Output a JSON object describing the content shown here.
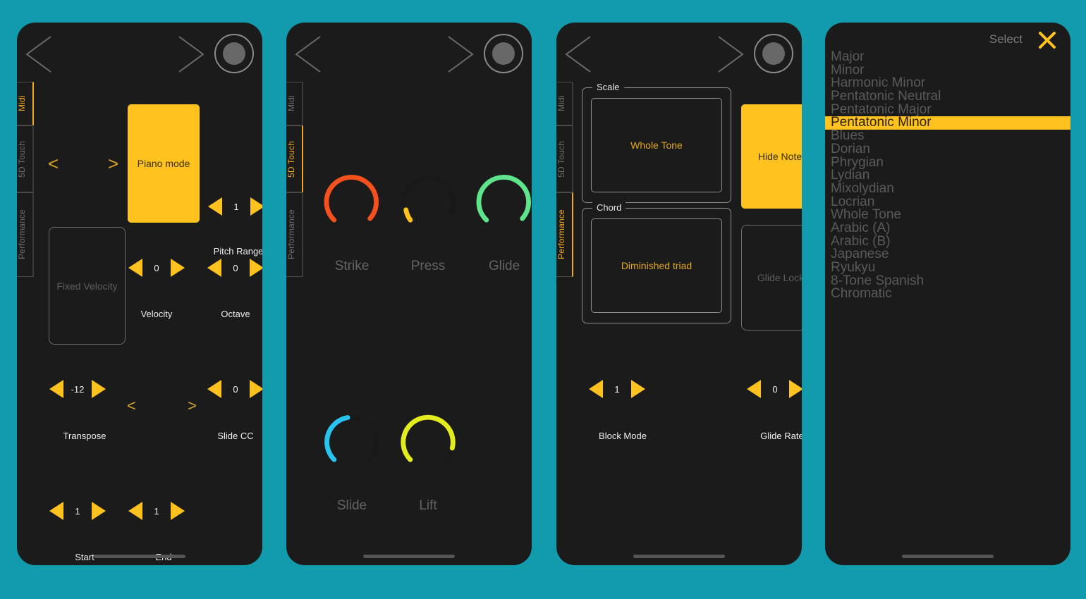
{
  "theme": {
    "page_background": "#119bad",
    "panel_background": "#1b1b1b",
    "accent": "#ffc21e",
    "accent_text": "#e3a81c",
    "muted_text": "#5a5a5a"
  },
  "panels": [
    {
      "id": "midi",
      "tabs": [
        {
          "label": "Midi",
          "active": true
        },
        {
          "label": "5D Touch",
          "active": false
        },
        {
          "label": "Performance",
          "active": false
        }
      ],
      "mode_button": {
        "label": "Piano mode",
        "state": "on"
      },
      "prev_chevron": "<",
      "next_chevron": ">",
      "fixed_velocity": {
        "label": "Fixed Velocity",
        "state": "off"
      },
      "steppers": [
        {
          "name": "pitch-range",
          "label": "Pitch Range",
          "value": "1"
        },
        {
          "name": "velocity",
          "label": "Velocity",
          "value": "0"
        },
        {
          "name": "octave",
          "label": "Octave",
          "value": "0"
        },
        {
          "name": "transpose",
          "label": "Transpose",
          "value": "-12"
        },
        {
          "name": "slide-cc",
          "label": "Slide CC",
          "value": "0"
        },
        {
          "name": "start",
          "label": "Start",
          "value": "1"
        },
        {
          "name": "end",
          "label": "End",
          "value": "1"
        }
      ],
      "mid_chevrons": {
        "left": "<",
        "right": ">"
      }
    },
    {
      "id": "5d-touch",
      "tabs": [
        {
          "label": "Midi",
          "active": false
        },
        {
          "label": "5D Touch",
          "active": true
        },
        {
          "label": "Performance",
          "active": false
        }
      ],
      "knobs": [
        {
          "label": "Strike",
          "color": "#f4511e",
          "value_pct": 86
        },
        {
          "label": "Press",
          "color": "#ffc21e",
          "value_pct": 14
        },
        {
          "label": "Glide",
          "color": "#5ee48a",
          "value_pct": 86
        },
        {
          "label": "Slide",
          "color": "#29c3ef",
          "value_pct": 48
        },
        {
          "label": "Lift",
          "color": "#e3ec1d",
          "value_pct": 72
        }
      ]
    },
    {
      "id": "performance",
      "tabs": [
        {
          "label": "Midi",
          "active": false
        },
        {
          "label": "5D Touch",
          "active": false
        },
        {
          "label": "Performance",
          "active": true
        }
      ],
      "groups": [
        {
          "legend": "Scale",
          "value": "Whole Tone"
        },
        {
          "legend": "Chord",
          "value": "Diminished triad"
        }
      ],
      "side_buttons": [
        {
          "label": "Hide Note",
          "state": "on"
        },
        {
          "label": "Glide Lock",
          "state": "off"
        }
      ],
      "steppers": [
        {
          "name": "block-mode",
          "label": "Block Mode",
          "value": "1"
        },
        {
          "name": "glide-rate",
          "label": "Glide Rate",
          "value": "0"
        }
      ]
    },
    {
      "id": "scale-select",
      "title": "Select",
      "close_icon": "close-icon",
      "selected": "Pentatonic Minor",
      "options": [
        "Major",
        "Minor",
        "Harmonic Minor",
        "Pentatonic Neutral",
        "Pentatonic Major",
        "Pentatonic Minor",
        "Blues",
        "Dorian",
        "Phrygian",
        "Lydian",
        "Mixolydian",
        "Locrian",
        "Whole Tone",
        "Arabic (A)",
        "Arabic (B)",
        "Japanese",
        "Ryukyu",
        "8-Tone Spanish",
        "Chromatic"
      ]
    }
  ]
}
